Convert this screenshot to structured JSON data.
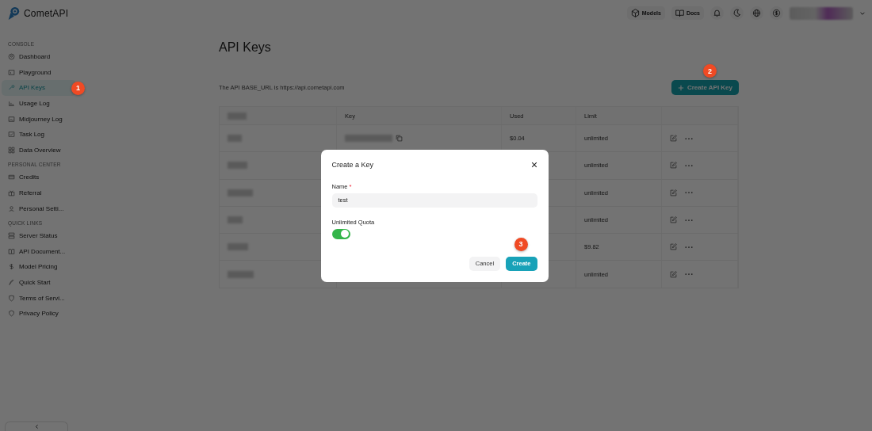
{
  "brand": "CometAPI",
  "header": {
    "links": [
      {
        "label": "Models"
      },
      {
        "label": "Docs"
      }
    ]
  },
  "sidebar": {
    "sections": [
      {
        "title": "CONSOLE",
        "items": [
          {
            "label": "Dashboard",
            "selected": false
          },
          {
            "label": "Playground",
            "selected": false
          },
          {
            "label": "API Keys",
            "selected": true
          },
          {
            "label": "Usage Log",
            "selected": false
          },
          {
            "label": "Midjourney Log",
            "selected": false
          },
          {
            "label": "Task Log",
            "selected": false
          },
          {
            "label": "Data Overview",
            "selected": false
          }
        ]
      },
      {
        "title": "PERSONAL CENTER",
        "items": [
          {
            "label": "Credits",
            "selected": false
          },
          {
            "label": "Referral",
            "selected": false
          },
          {
            "label": "Personal Setti...",
            "selected": false
          }
        ]
      },
      {
        "title": "QUICK LINKS",
        "items": [
          {
            "label": "Server Status",
            "selected": false
          },
          {
            "label": "API Document...",
            "selected": false
          },
          {
            "label": "Model Pricing",
            "selected": false
          },
          {
            "label": "Quick Start",
            "selected": false
          },
          {
            "label": "Terms of Servi...",
            "selected": false
          },
          {
            "label": "Privacy Policy",
            "selected": false
          }
        ]
      }
    ]
  },
  "page": {
    "title": "API Keys",
    "base_url_note": "The API BASE_URL is https://api.cometapi.com",
    "create_button": "Create API Key",
    "table": {
      "columns": [
        "Key",
        "Used",
        "Limit"
      ],
      "rows": [
        {
          "used": "$0.04",
          "limit": "unlimited"
        },
        {
          "limit": "unlimited"
        },
        {
          "limit": "unlimited"
        },
        {
          "limit": "unlimited"
        },
        {
          "limit": "$9.82"
        },
        {
          "limit": "unlimited"
        }
      ]
    }
  },
  "dialog": {
    "title": "Create a Key",
    "name_label": "Name",
    "required_mark": "*",
    "name_value": "test",
    "toggle_label": "Unlimited Quota",
    "toggle_on": true,
    "buttons": [
      {
        "label": "Cancel",
        "kind": "secondary"
      },
      {
        "label": "Create",
        "kind": "primary"
      }
    ]
  },
  "callouts": [
    "1",
    "2",
    "3"
  ]
}
